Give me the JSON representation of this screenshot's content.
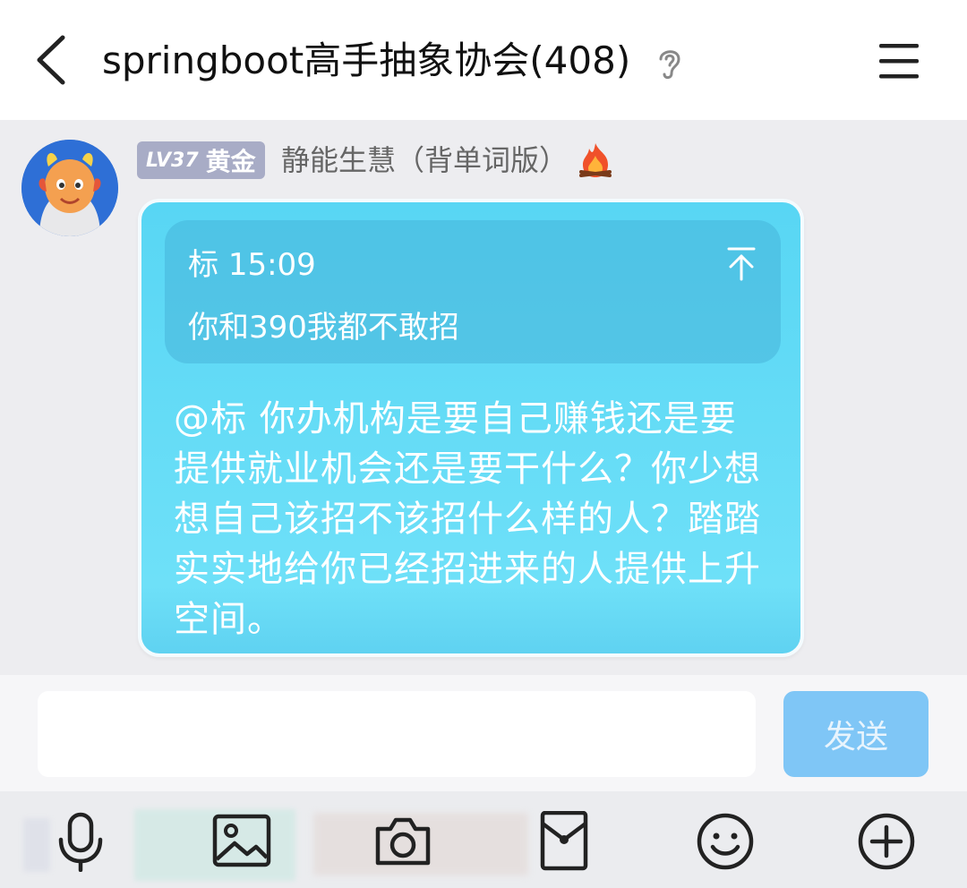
{
  "header": {
    "title": "springboot高手抽象协会(408)",
    "back_icon": "chevron-left-icon",
    "ear_icon": "ear-icon",
    "menu_icon": "hamburger-menu-icon"
  },
  "message": {
    "level_prefix": "LV37",
    "level_name": "黄金",
    "sender": "静能生慧（背单词版）",
    "badge_icon": "fire-icon",
    "quote": {
      "author": "标",
      "time": "15:09",
      "text": "你和390我都不敢招",
      "jump_icon": "jump-to-top-icon"
    },
    "text": "@标 你办机构是要自己赚钱还是要提供就业机会还是要干什么？你少想想自己该招不该招什么样的人？踏踏实实地给你已经招进来的人提供上升空间。"
  },
  "composer": {
    "input_value": "",
    "send_label": "发送"
  },
  "toolbar": {
    "items": [
      "microphone-icon",
      "image-icon",
      "camera-icon",
      "red-packet-icon",
      "emoji-icon",
      "plus-icon"
    ]
  },
  "colors": {
    "bubble": "#62dbf6",
    "send_button": "#7fc6f6",
    "level_badge": "#a8acc6"
  }
}
